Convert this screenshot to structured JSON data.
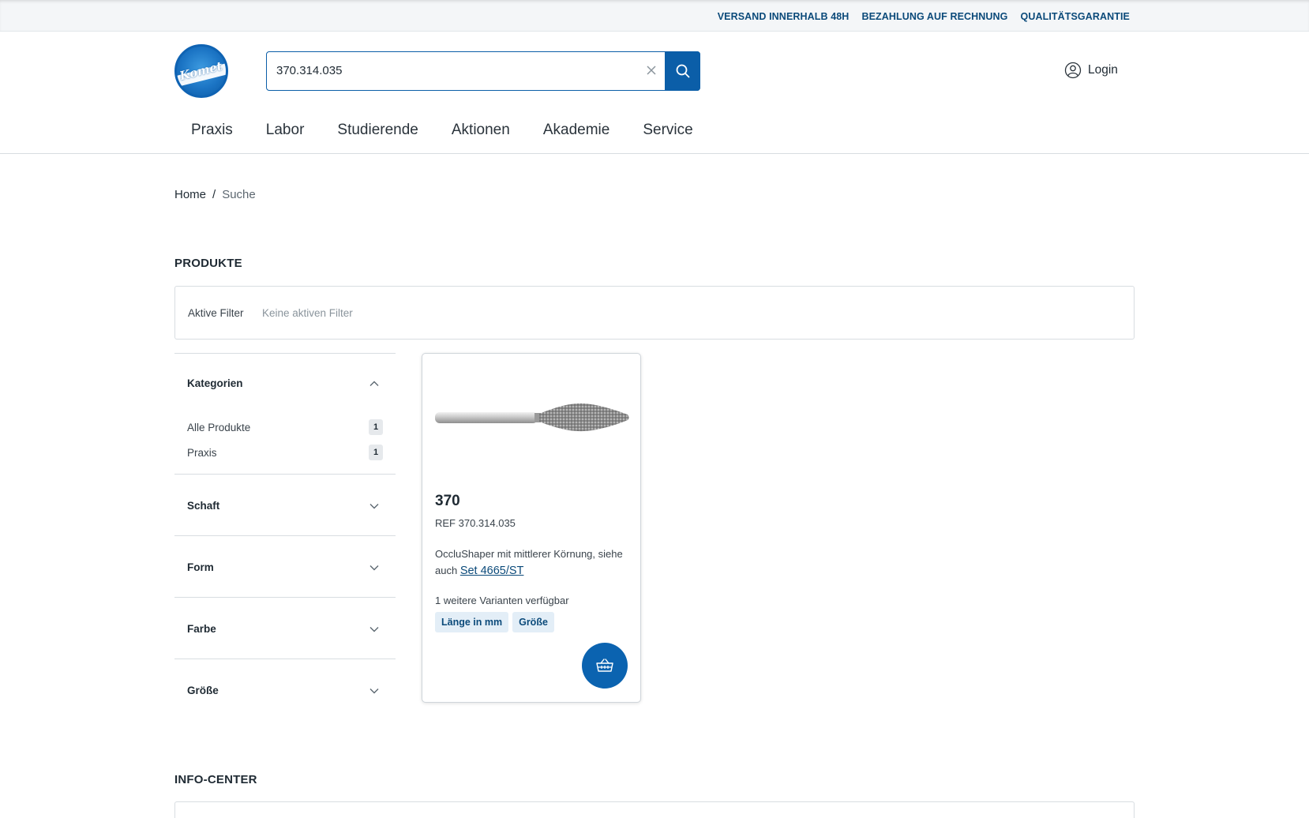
{
  "topbar": {
    "links": [
      "VERSAND INNERHALB 48H",
      "BEZAHLUNG AUF RECHNUNG",
      "QUALITÄTSGARANTIE"
    ]
  },
  "header": {
    "logo_text": "Komet",
    "search": {
      "value": "370.314.035",
      "clear_icon": "close-icon",
      "submit_icon": "search-icon"
    },
    "login_label": "Login"
  },
  "nav": {
    "items": [
      "Praxis",
      "Labor",
      "Studierende",
      "Aktionen",
      "Akademie",
      "Service"
    ]
  },
  "breadcrumb": {
    "home": "Home",
    "separator": "/",
    "current": "Suche"
  },
  "products_section": {
    "title": "PRODUKTE",
    "active_filter_label": "Aktive Filter",
    "active_filter_value": "Keine aktiven Filter"
  },
  "facets": {
    "kategorien": {
      "title": "Kategorien",
      "items": [
        {
          "label": "Alle Produkte",
          "count": "1"
        },
        {
          "label": "Praxis",
          "count": "1"
        }
      ]
    },
    "schaft": "Schaft",
    "form": "Form",
    "farbe": "Farbe",
    "groesse": "Größe"
  },
  "product": {
    "title": "370",
    "ref": "REF 370.314.035",
    "desc_prefix": "OccluShaper mit mittlerer Körnung, siehe auch ",
    "desc_link": "Set 4665/ST",
    "variants": "1 weitere Varianten verfügbar",
    "tags": [
      "Länge in mm",
      "Größe"
    ],
    "cart_icon": "basket-icon"
  },
  "info_section": {
    "title": "INFO-CENTER"
  },
  "colors": {
    "brand_blue": "#0b5ea8",
    "link_blue": "#0b4a7a",
    "tag_bg": "#e3eef7"
  }
}
